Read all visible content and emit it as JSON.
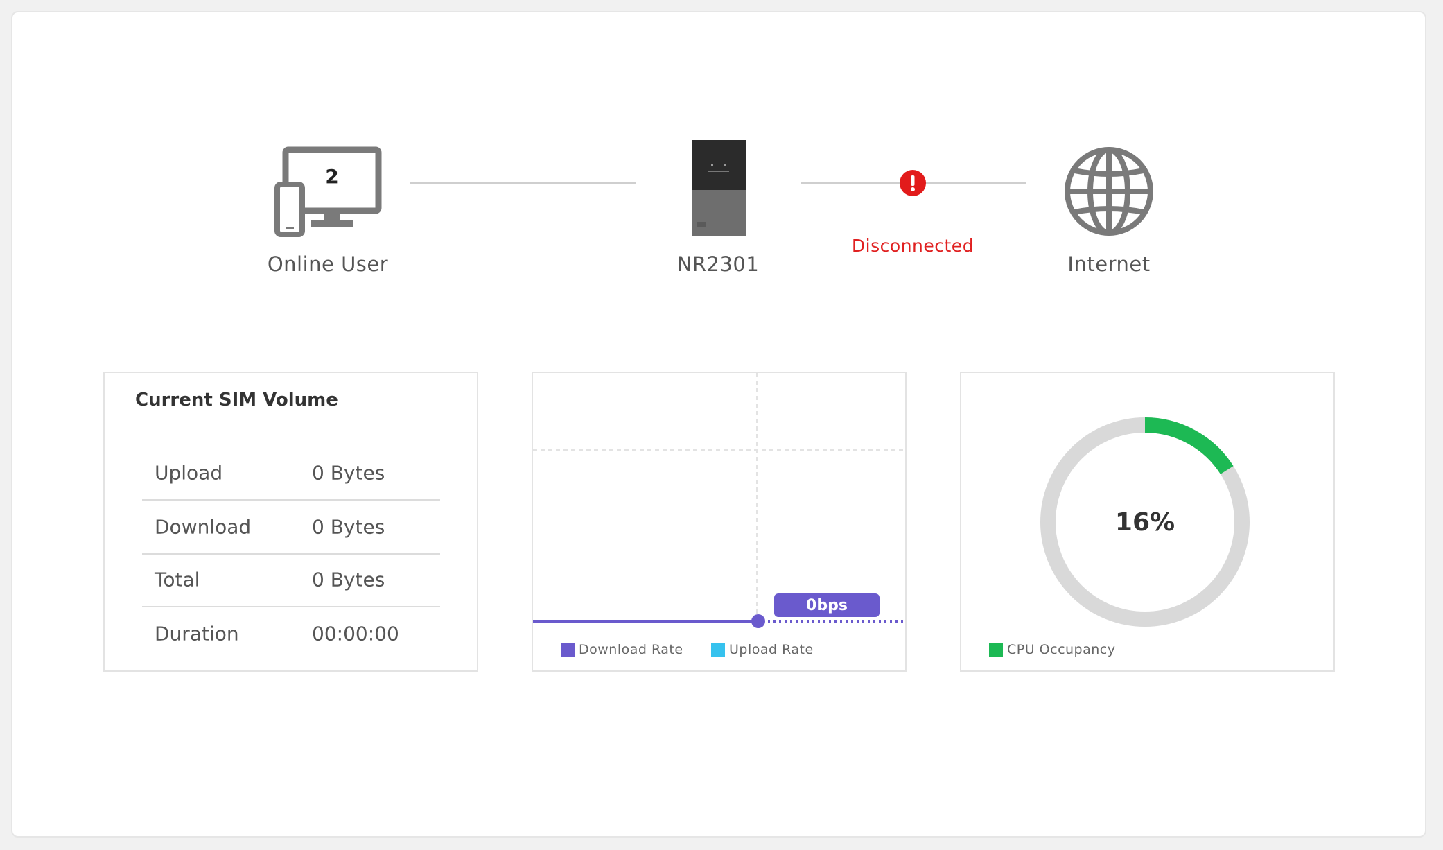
{
  "topology": {
    "online_user": {
      "count": "2",
      "label": "Online User"
    },
    "device": {
      "label": "NR2301"
    },
    "connection_status": {
      "text": "Disconnected",
      "color": "#e02020",
      "icon": "error-icon"
    },
    "internet": {
      "label": "Internet",
      "icon": "globe-icon"
    }
  },
  "sim_volume": {
    "title": "Current SIM Volume",
    "rows": [
      {
        "label": "Upload",
        "value": "0 Bytes"
      },
      {
        "label": "Download",
        "value": "0 Bytes"
      },
      {
        "label": "Total",
        "value": "0 Bytes"
      },
      {
        "label": "Duration",
        "value": "00:00:00"
      }
    ]
  },
  "rate_chart": {
    "tooltip": "0bps",
    "legend": [
      {
        "label": "Download Rate",
        "color": "#6a5acd"
      },
      {
        "label": "Upload Rate",
        "color": "#36c2ee"
      }
    ]
  },
  "cpu": {
    "percent_text": "16%",
    "percent": 16,
    "legend_label": "CPU Occupancy",
    "color": "#1db954",
    "track_color": "#d9d9d9"
  }
}
